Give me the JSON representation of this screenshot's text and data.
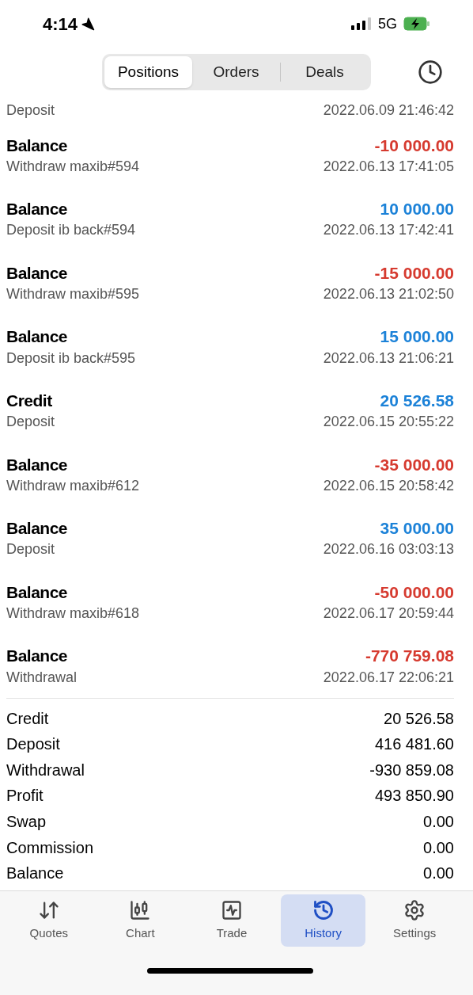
{
  "status_bar": {
    "time": "4:14",
    "network": "5G"
  },
  "tabs": [
    {
      "label": "Positions",
      "selected": true
    },
    {
      "label": "Orders",
      "selected": false
    },
    {
      "label": "Deals",
      "selected": false
    }
  ],
  "partial_row": {
    "comment": "Deposit",
    "time": "2022.06.09 21:46:42"
  },
  "deals": [
    {
      "type": "Balance",
      "comment": "Withdraw maxib#594",
      "amount": "-10 000.00",
      "color": "#d63a2f",
      "time": "2022.06.13 17:41:05"
    },
    {
      "type": "Balance",
      "comment": "Deposit ib back#594",
      "amount": "10 000.00",
      "color": "#1c82d8",
      "time": "2022.06.13 17:42:41"
    },
    {
      "type": "Balance",
      "comment": "Withdraw maxib#595",
      "amount": "-15 000.00",
      "color": "#d63a2f",
      "time": "2022.06.13 21:02:50"
    },
    {
      "type": "Balance",
      "comment": "Deposit ib back#595",
      "amount": "15 000.00",
      "color": "#1c82d8",
      "time": "2022.06.13 21:06:21"
    },
    {
      "type": "Credit",
      "comment": "Deposit",
      "amount": "20 526.58",
      "color": "#1c82d8",
      "time": "2022.06.15 20:55:22"
    },
    {
      "type": "Balance",
      "comment": "Withdraw maxib#612",
      "amount": "-35 000.00",
      "color": "#d63a2f",
      "time": "2022.06.15 20:58:42"
    },
    {
      "type": "Balance",
      "comment": "Deposit",
      "amount": "35 000.00",
      "color": "#1c82d8",
      "time": "2022.06.16 03:03:13"
    },
    {
      "type": "Balance",
      "comment": "Withdraw maxib#618",
      "amount": "-50 000.00",
      "color": "#d63a2f",
      "time": "2022.06.17 20:59:44"
    },
    {
      "type": "Balance",
      "comment": "Withdrawal",
      "amount": "-770 759.08",
      "color": "#d63a2f",
      "time": "2022.06.17 22:06:21"
    }
  ],
  "summary": [
    {
      "label": "Credit",
      "value": "20 526.58"
    },
    {
      "label": "Deposit",
      "value": "416 481.60"
    },
    {
      "label": "Withdrawal",
      "value": "-930 859.08"
    },
    {
      "label": "Profit",
      "value": "493 850.90"
    },
    {
      "label": "Swap",
      "value": "0.00"
    },
    {
      "label": "Commission",
      "value": "0.00"
    },
    {
      "label": "Balance",
      "value": "0.00"
    }
  ],
  "nav": [
    {
      "kind": "quotes",
      "label": "Quotes",
      "selected": false
    },
    {
      "kind": "chart",
      "label": "Chart",
      "selected": false
    },
    {
      "kind": "trade",
      "label": "Trade",
      "selected": false
    },
    {
      "kind": "history",
      "label": "History",
      "selected": true
    },
    {
      "kind": "settings",
      "label": "Settings",
      "selected": false
    }
  ]
}
